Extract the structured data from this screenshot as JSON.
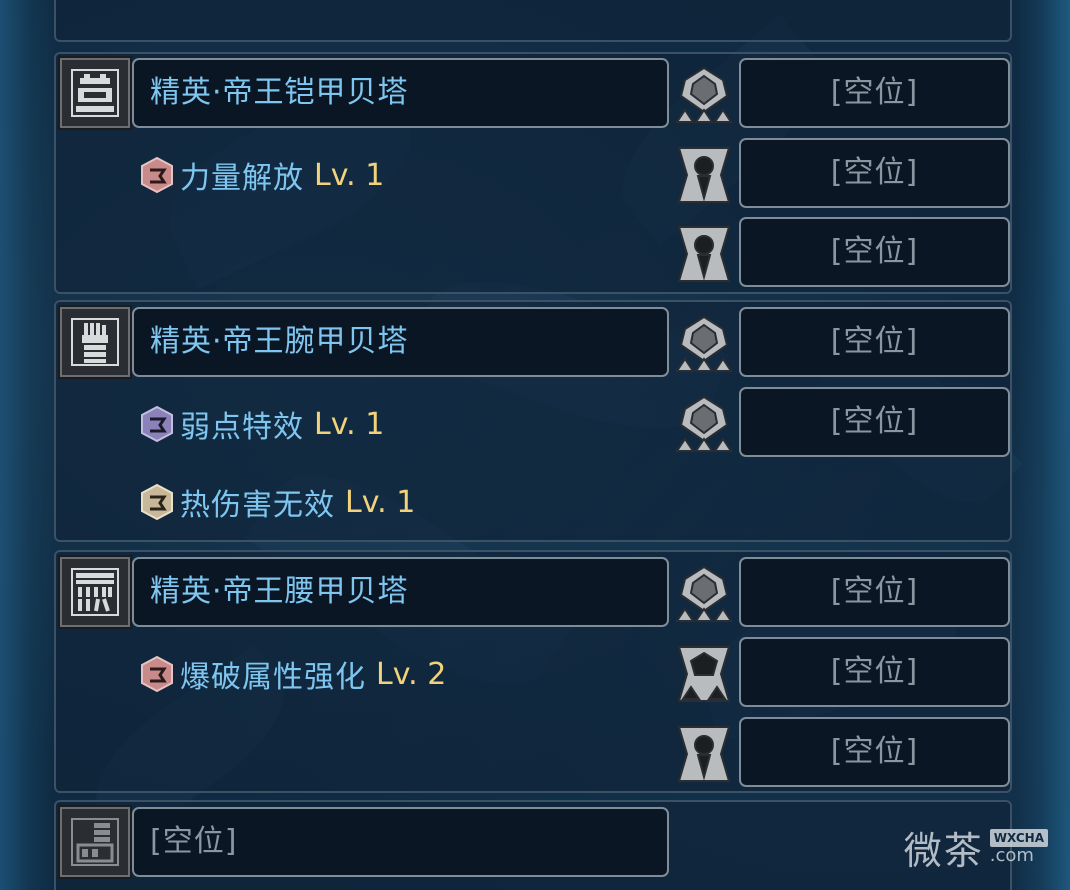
{
  "equipment": [
    {
      "piece": "helm",
      "name": "精英·帝王铠甲贝塔",
      "slots": [
        {
          "icon": "decoration-slot-lv3-icon",
          "value": "[空位]"
        },
        {
          "icon": "decoration-slot-lv1-icon",
          "value": "[空位]"
        },
        {
          "icon": "decoration-slot-lv1-icon",
          "value": "[空位]"
        }
      ],
      "skills": [
        {
          "name": "力量解放",
          "level": "Lv. 1",
          "gem_color": "#c98a8a"
        }
      ]
    },
    {
      "piece": "arms",
      "name": "精英·帝王腕甲贝塔",
      "slots": [
        {
          "icon": "decoration-slot-lv3-icon",
          "value": "[空位]"
        },
        {
          "icon": "decoration-slot-lv3-icon",
          "value": "[空位]"
        }
      ],
      "skills": [
        {
          "name": "弱点特效",
          "level": "Lv. 1",
          "gem_color": "#8a82b8"
        },
        {
          "name": "热伤害无效",
          "level": "Lv. 1",
          "gem_color": "#c8b89a"
        }
      ]
    },
    {
      "piece": "waist",
      "name": "精英·帝王腰甲贝塔",
      "slots": [
        {
          "icon": "decoration-slot-lv3-icon",
          "value": "[空位]"
        },
        {
          "icon": "decoration-slot-lv2-icon",
          "value": "[空位]"
        },
        {
          "icon": "decoration-slot-lv1-icon",
          "value": "[空位]"
        }
      ],
      "skills": [
        {
          "name": "爆破属性强化",
          "level": "Lv. 2",
          "gem_color": "#c98a8a"
        }
      ]
    },
    {
      "piece": "legs",
      "name": "[空位]"
    }
  ],
  "watermark": {
    "cn": "微茶",
    "tag": "WXCHA",
    "domain": ".com"
  }
}
